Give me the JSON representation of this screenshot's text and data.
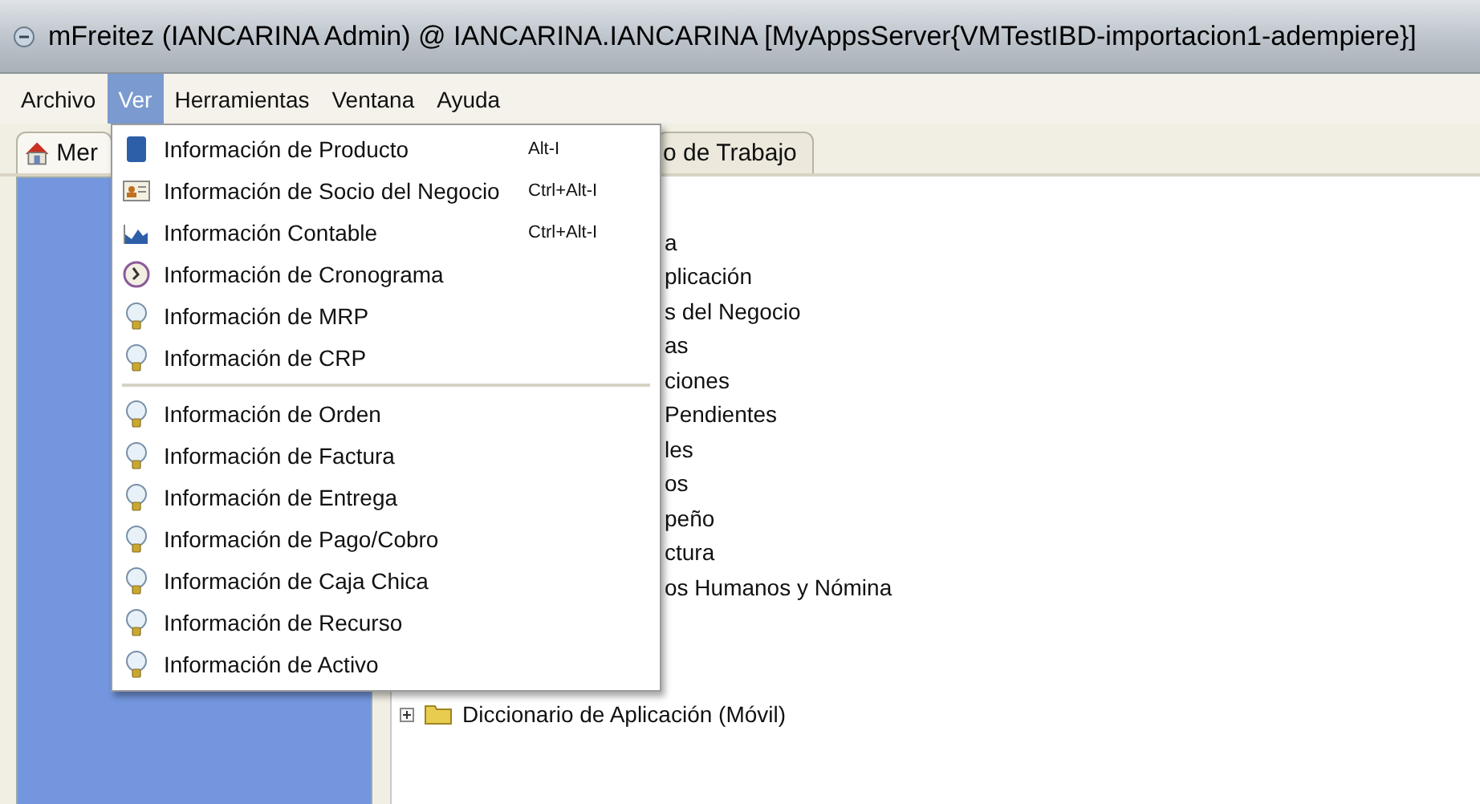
{
  "window": {
    "title": "mFreitez (IANCARINA Admin) @ IANCARINA.IANCARINA [MyAppsServer{VMTestIBD-importacion1-adempiere}]"
  },
  "menubar": [
    {
      "label": "Archivo",
      "selected": false
    },
    {
      "label": "Ver",
      "selected": true
    },
    {
      "label": "Herramientas",
      "selected": false
    },
    {
      "label": "Ventana",
      "selected": false
    },
    {
      "label": "Ayuda",
      "selected": false
    }
  ],
  "open_menu": {
    "items": [
      {
        "kind": "product",
        "label": "Información de Producto",
        "shortcut": "Alt-I"
      },
      {
        "kind": "partner",
        "label": "Información de Socio del Negocio",
        "shortcut": "Ctrl+Alt-I"
      },
      {
        "kind": "chart",
        "label": "Información Contable",
        "shortcut": "Ctrl+Alt-I"
      },
      {
        "kind": "clock",
        "label": "Información de Cronograma"
      },
      {
        "kind": "bulb",
        "label": "Información de MRP"
      },
      {
        "kind": "bulb",
        "label": "Información de CRP"
      },
      {
        "kind": "separator"
      },
      {
        "kind": "bulb",
        "label": "Información de Orden"
      },
      {
        "kind": "bulb",
        "label": "Información de Factura"
      },
      {
        "kind": "bulb",
        "label": "Información de Entrega"
      },
      {
        "kind": "bulb",
        "label": "Información de Pago/Cobro"
      },
      {
        "kind": "bulb",
        "label": "Información de Caja Chica"
      },
      {
        "kind": "bulb",
        "label": "Información de Recurso"
      },
      {
        "kind": "bulb",
        "label": "Información de Activo"
      }
    ]
  },
  "tabs": [
    {
      "label": "Mer",
      "selected": true
    },
    {
      "label": "o de Trabajo",
      "selected": false
    }
  ],
  "tree": {
    "items": [
      {
        "label": "a"
      },
      {
        "label": "plicación"
      },
      {
        "label": "s del Negocio"
      },
      {
        "label": "as"
      },
      {
        "label": "ciones"
      },
      {
        "label": "Pendientes"
      },
      {
        "label": "les"
      },
      {
        "label": "os"
      },
      {
        "label": "peño"
      },
      {
        "label": "ctura"
      },
      {
        "label": "os Humanos y Nómina"
      },
      {
        "label": "Diccionario de Aplicación (Móvil)",
        "kind": "folder"
      }
    ]
  }
}
